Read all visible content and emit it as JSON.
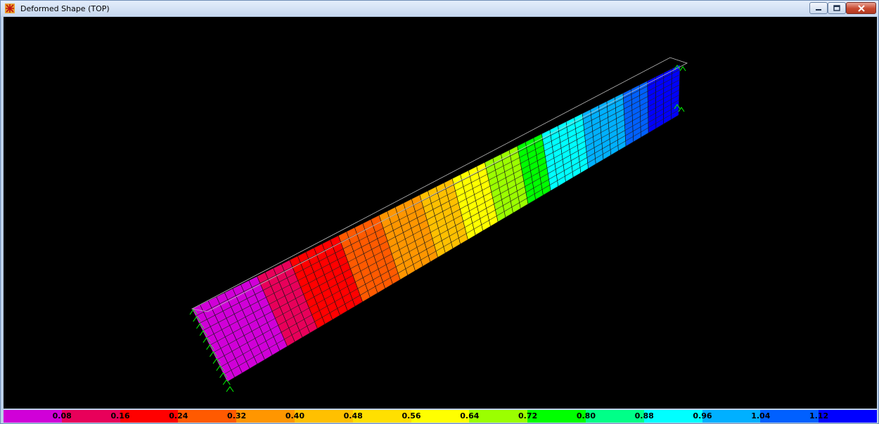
{
  "window": {
    "title": "Deformed Shape (TOP)"
  },
  "icons": {
    "app": "sap-structure-icon",
    "minimize": "minimize-icon",
    "maximize": "maximize-icon",
    "close": "close-icon"
  },
  "legend": {
    "colors": [
      "#d000d8",
      "#e8005a",
      "#ff0000",
      "#ff5a00",
      "#ff9600",
      "#ffc000",
      "#ffe000",
      "#ffff00",
      "#9bff00",
      "#00ff00",
      "#00ff88",
      "#00ffff",
      "#00b0ff",
      "#0060ff",
      "#0000ff"
    ],
    "labels": [
      "0.08",
      "0.16",
      "0.24",
      "0.32",
      "0.40",
      "0.48",
      "0.56",
      "0.64",
      "0.72",
      "0.80",
      "0.88",
      "0.96",
      "1.04",
      "1.12"
    ]
  },
  "model": {
    "background": "#000000",
    "undeformed_color": "#bfbfbf",
    "support_color": "#00ff00"
  }
}
